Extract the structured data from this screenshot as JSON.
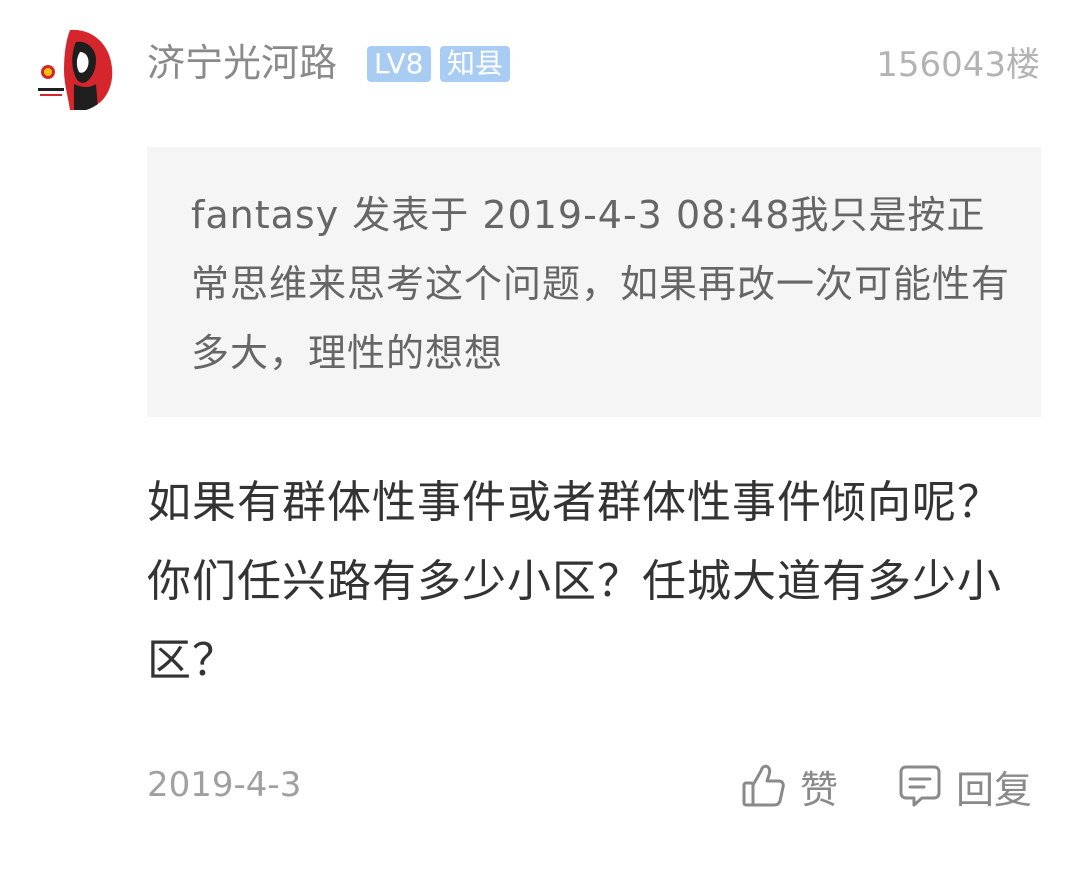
{
  "post": {
    "username": "济宁光河路",
    "level_badge": "LV8",
    "rank_badge": "知县",
    "floor": "156043楼",
    "quote": "fantasy 发表于 2019-4-3 08:48我只是按正常思维来思考这个问题，如果再改一次可能性有多大，理性的想想",
    "content": "如果有群体性事件或者群体性事件倾向呢？你们任兴路有多少小区？任城大道有多少小区？",
    "date": "2019-4-3"
  },
  "actions": {
    "like_label": "赞",
    "reply_label": "回复"
  },
  "icons": {
    "like": "thumbs-up-icon",
    "reply": "comment-icon",
    "avatar": "user-avatar"
  },
  "colors": {
    "badge": "#a9cdf2",
    "quote_background": "#f5f5f5",
    "avatar_red": "#d4262c"
  }
}
